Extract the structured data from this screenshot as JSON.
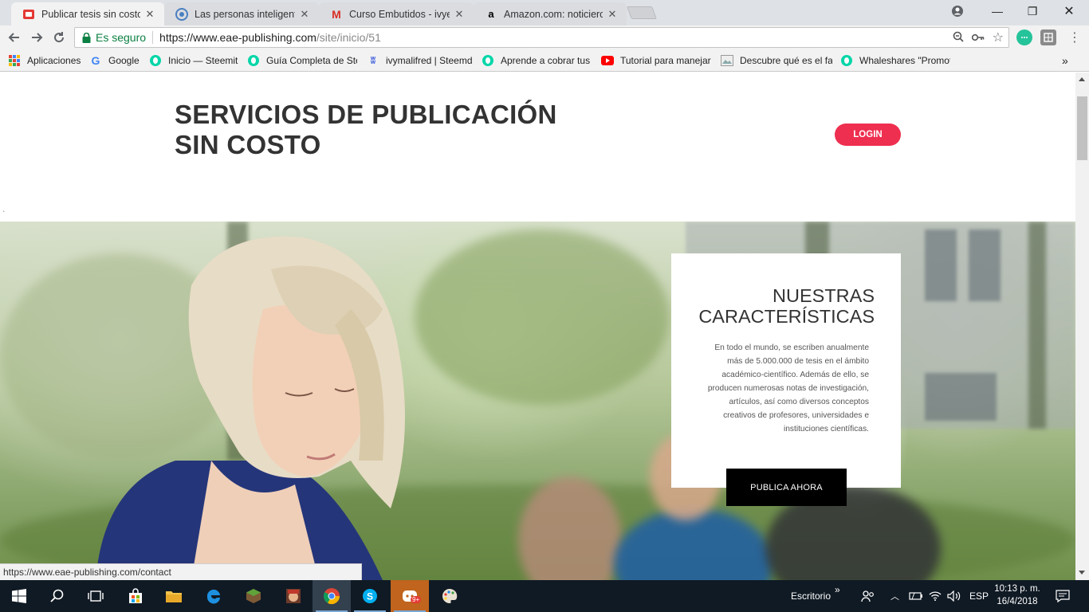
{
  "browser": {
    "tabs": [
      {
        "title": "Publicar tesis sin costo | E",
        "favicon": "eae-icon",
        "active": true
      },
      {
        "title": "Las personas inteligentes",
        "favicon": "steemit-icon",
        "active": false
      },
      {
        "title": "Curso Embutidos - ivyesc",
        "favicon": "gmail-icon",
        "active": false
      },
      {
        "title": "Amazon.com: noticiero vi",
        "favicon": "amazon-icon",
        "active": false
      }
    ],
    "secure_label": "Es seguro",
    "url_scheme_host": "https://www.eae-publishing.com",
    "url_path": "/site/inicio/51",
    "bookmarks": [
      {
        "label": "Aplicaciones",
        "icon": "apps-icon"
      },
      {
        "label": "Google",
        "icon": "google-icon"
      },
      {
        "label": "Inicio — Steemit",
        "icon": "steemit-icon"
      },
      {
        "label": "Guía Completa de Ste",
        "icon": "steemit-icon"
      },
      {
        "label": "ivymalifred | Steemd",
        "icon": "steemd-icon"
      },
      {
        "label": "Aprende a cobrar tus",
        "icon": "steemit-icon"
      },
      {
        "label": "Tutorial para manejar",
        "icon": "youtube-icon"
      },
      {
        "label": "Descubre qué es el fa",
        "icon": "image-icon"
      },
      {
        "label": "Whaleshares \"Promot",
        "icon": "steemit-icon"
      }
    ],
    "more_bookmarks": "»",
    "status_url": "https://www.eae-publishing.com/contact"
  },
  "page": {
    "title_line1": "SERVICIOS DE PUBLICACIÓN",
    "title_line2": "SIN COSTO",
    "login_label": "LOGIN",
    "tick": "`",
    "features": {
      "title_line1": "NUESTRAS",
      "title_line2": "CARACTERÍSTICAS",
      "body": "En todo el mundo, se escriben anualmente más de 5.000.000 de tesis en el ámbito académico-científico. Además de ello, se producen numerosas notas de investigación, artículos, así como diversos conceptos creativos de profesores, universidades e instituciones científicas.",
      "cta_label": "PUBLICA AHORA"
    }
  },
  "taskbar": {
    "desktop_label": "Escritorio",
    "language": "ESP",
    "time": "10:13 p. m.",
    "date": "16/4/2018",
    "badge": "9+"
  },
  "colors": {
    "accent": "#ee2f4f",
    "secure_green": "#0b8043",
    "taskbar": "#101a24"
  }
}
